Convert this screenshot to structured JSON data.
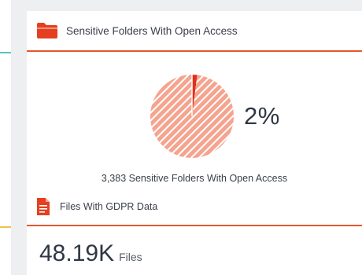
{
  "colors": {
    "accent": "#e4572e",
    "pie_fill": "#f5a48f",
    "pie_stripe": "#ffffff",
    "pie_highlight": "#e0321b"
  },
  "card_open_access": {
    "icon": "folder-icon",
    "title": "Sensitive Folders With Open Access",
    "percent_label": "2%",
    "caption": "3,383 Sensitive Folders With Open Access",
    "chart_data": {
      "type": "pie",
      "values": [
        2,
        98
      ]
    }
  },
  "card_gdpr": {
    "icon": "document-icon",
    "title": "Files With GDPR Data",
    "value": "48.19K",
    "unit": "Files"
  }
}
